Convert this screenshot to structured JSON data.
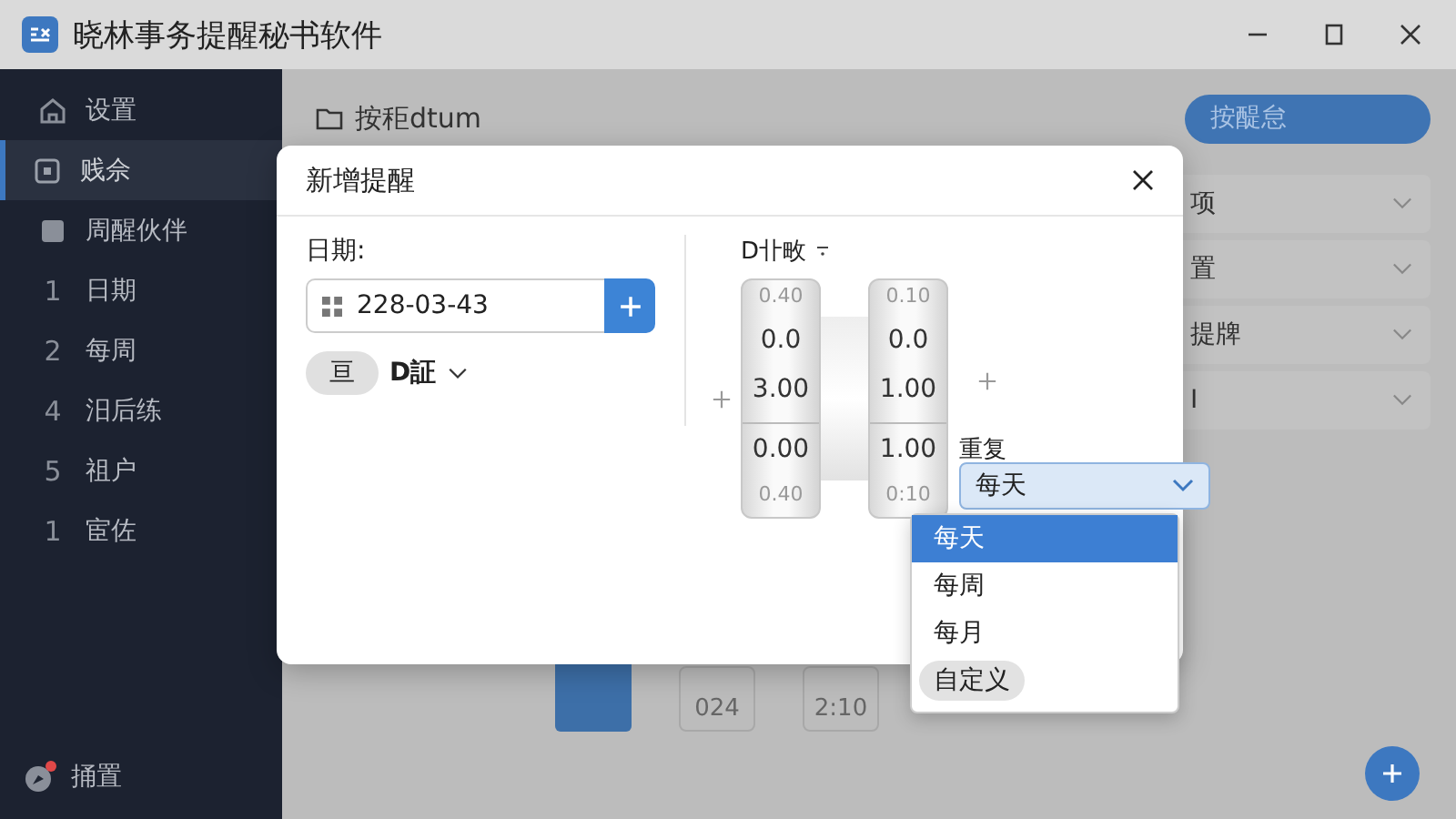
{
  "window": {
    "title": "晓林事务提醒秘书软件"
  },
  "sidebar": {
    "items": [
      {
        "kind": "home",
        "label": "设置",
        "selected": false
      },
      {
        "kind": "box",
        "label": "贱佘",
        "selected": true
      },
      {
        "kind": "square",
        "label": "周醒伙伴",
        "selected": false
      },
      {
        "kind": "numbered",
        "number": "1",
        "label": "日期",
        "selected": false
      },
      {
        "kind": "numbered",
        "number": "2",
        "label": "每周",
        "selected": false
      },
      {
        "kind": "numbered",
        "number": "4",
        "label": "汨后练",
        "selected": false
      },
      {
        "kind": "numbered",
        "number": "5",
        "label": "祖户",
        "selected": false
      },
      {
        "kind": "numbered",
        "number": "1",
        "label": "宦佐",
        "selected": false
      }
    ],
    "footer": {
      "label": "捅置",
      "notification": true
    }
  },
  "header": {
    "title": "按秬dtum",
    "button": "按醍怠"
  },
  "list_rows": [
    "项",
    "置",
    "提牌",
    "I"
  ],
  "background_pickers": [
    "024",
    "2:10"
  ],
  "dialog": {
    "title": "新增提醒",
    "date_label": "日期:",
    "date_value": "228-03-43",
    "chip": "亘",
    "dropdown_label": "D証",
    "picker_label": "D卝畋",
    "wheels": [
      {
        "values": [
          "0.40",
          "0.0",
          "3.00",
          "0.00",
          "0.40"
        ]
      },
      {
        "values": [
          "0.10",
          "0.0",
          "1.00",
          "1.00",
          "0:10"
        ]
      }
    ],
    "repeat_label": "重复",
    "repeat_value": "每天",
    "repeat_options": [
      {
        "label": "每天",
        "selected": true,
        "hovered": false
      },
      {
        "label": "每周",
        "selected": false,
        "hovered": false
      },
      {
        "label": "每月",
        "selected": false,
        "hovered": false
      },
      {
        "label": "自定义",
        "selected": false,
        "hovered": true
      }
    ]
  }
}
